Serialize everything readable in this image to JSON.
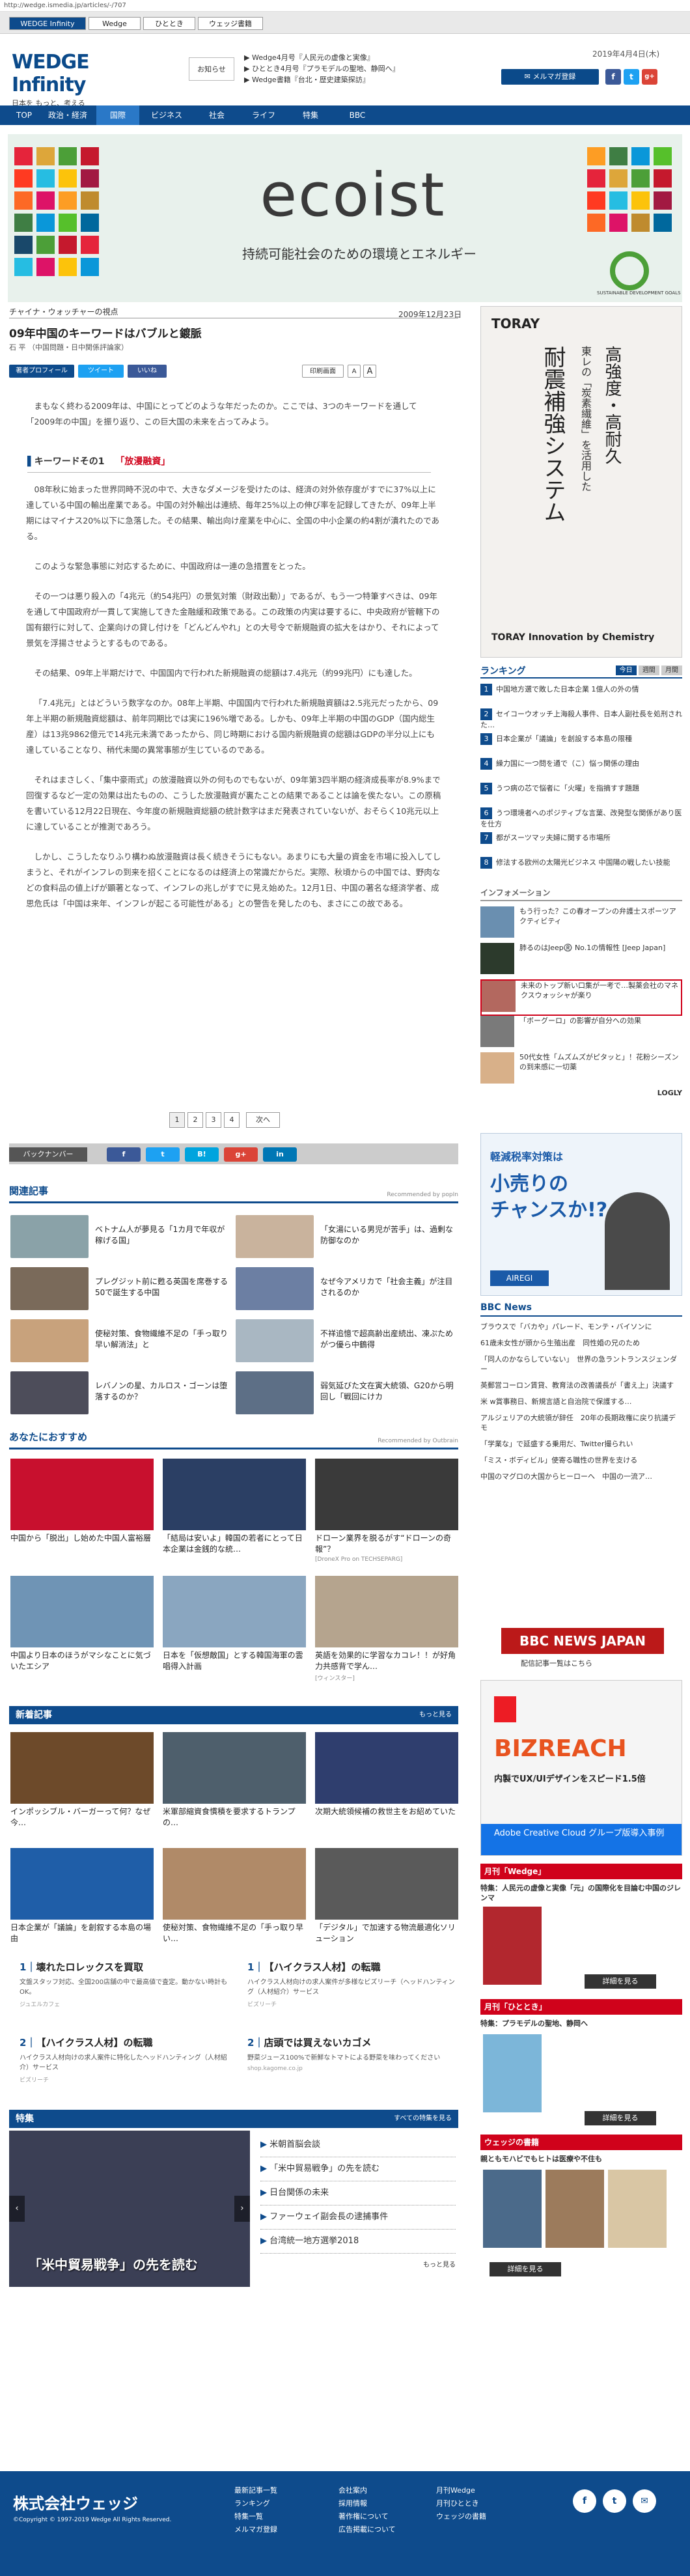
{
  "url": "http://wedge.ismedia.jp/articles/-/707",
  "top_tabs": [
    "WEDGE Infinity",
    "Wedge",
    "ひととき",
    "ウェッジ書籍"
  ],
  "logo": {
    "main": "WEDGE Infinity",
    "sub": "日本を もっと、考える"
  },
  "notice": "お知らせ",
  "header_news": [
    "Wedge4月号『人民元の虚像と実像』",
    "ひととき4月号『プラモデルの聖地、静岡へ』",
    "Wedge書籍『台北・歴史建築探訪』"
  ],
  "date": "2019年4月4日(木)",
  "mail_button": "メルマガ登録",
  "social": [
    "f",
    "t",
    "g+"
  ],
  "nav": [
    "TOP",
    "政治・経済",
    "国際",
    "ビジネス",
    "社会",
    "ライフ",
    "特集",
    "BBC"
  ],
  "banner": {
    "title": "ecoist",
    "subtitle": "持続可能社会のための環境とエネルギー",
    "sdgs_label": "SUSTAINABLE DEVELOPMENT GOALS"
  },
  "breadcrumb": "チャイナ・ウォッチャーの視点",
  "article": {
    "date": "2009年12月23日",
    "title": "09年中国のキーワードはバブルと鍍脈",
    "author": "石 平 （中国問題・日中関係評論家）",
    "buttons": [
      "著者プロフィール",
      "ツイート",
      "いいね",
      "印刷画面",
      "A",
      "A"
    ],
    "intro": "まもなく終わる2009年は、中国にとってどのような年だったのか。ここでは、3つのキーワードを通して「2009年の中国」を振り返り、この巨大国の未来を占ってみよう。",
    "keyword_label": "キーワードその1",
    "keyword": "「放漫融資」",
    "paragraphs": [
      "08年秋に始まった世界同時不況の中で、大きなダメージを受けたのは、経済の対外依存度がすでに37%以上に達している中国の輸出産業である。中国の対外輸出は連続、毎年25%以上の伸び率を記録してきたが、09年上半期にはマイナス20%以下に急落した。その結果、輸出向け産業を中心に、全国の中小企業の約4割が潰れたのである。",
      "このような緊急事態に対応するために、中国政府は一連の急措置をとった。",
      "その一つは悪り殺入の「4兆元（約54兆円）の景気対策（財政出動）」であるが、もう一つ特筆すべきは、09年を通して中国政府が一貫して実施してきた金融緩和政策である。この政策の内実は要するに、中央政府が管轄下の国有銀行に対して、企業向けの貸し付けを「どんどんやれ」との大号令で新規融資の拡大をはかり、それによって景気を浮揚させようとするものである。",
      "その結果、09年上半期だけで、中国国内で行われた新規融資の総額は7.4兆元（約99兆円）にも達した。",
      "「7.4兆元」とはどういう数字なのか。08年上半期、中国国内で行われた新規融資額は2.5兆元だったから、09年上半期の新規融資総額は、前年同期比では実に196%増である。しかも、09年上半期の中国のGDP（国内総生産）は13兆9862億元で14兆元未満であったから、同じ時期における国内新規融資の総額はGDPの半分以上にも達していることなり、稍代未聞の異常事態が生じているのである。",
      "それはまさしく、「集中豪雨式」の放漫融資以外の何ものでもないが、09年第3四半期の経済成長率が8.9%まで回復するなど一定の効果は出たものの、こうした放漫融資が裏たことの結果であることは論を俟たない。この原稿を書いている12月22日現在、今年度の新規融資総額の統計数字はまだ発表されていないが、おそらく10兆元以上に達していることが推測であろう。",
      "しかし、こうしたなりふり構わぬ放漫融資は長く続きそうにもない。あまりにも大量の資金を市場に投入してしまうと、それがインフレの到来を招くことになるのは経済上の常識だからだ。実際、秋頃からの中国では、野肉などの食料品の値上げが顕著となって、インフレの兆しがすでに見え始めた。12月1日、中国の著名な経済学者、成思危氏は「中国は来年、インフレが起こる可能性がある」との警告を発したのも、まさにこの故である。"
    ]
  },
  "pager": [
    "1",
    "2",
    "3",
    "4",
    "次へ"
  ],
  "share": {
    "label": "バックナンバー",
    "buttons": [
      "f",
      "t",
      "B!",
      "g+",
      "in"
    ]
  },
  "related": {
    "title": "関連記事",
    "powered": "Recommended by popIn",
    "items": [
      "ベトナム人が夢見る「1カ月で年収が稼げる国」",
      "「女湯にいる男児が苦手」は、過剰な防御なのか",
      "プレグジット前に甦る英国を席巻する50で誕生する中国",
      "なぜ今アメリカで「社会主義」が注目されるのか",
      "使秘対策、食物繊維不足の「手っ取り早い解消法」と",
      "不祥追憶で超高齢出産続出、凍ぷためがつ優ら中鶴得",
      "レバノンの星、カルロス・ゴーンは堕落するのか？",
      "弱気延びた文在寅大統領、G20から明回し「戦回にけカ"
    ]
  },
  "recommend": {
    "title": "あなたにおすすめ",
    "powered": "Recommended by Outbrain",
    "items": [
      {
        "title": "中国から「脱出」し始めた中国人富裕層",
        "src": ""
      },
      {
        "title": "「結局は安いよ」韓国の若者にとって日本企業は金銭的な統…",
        "src": ""
      },
      {
        "title": "ドローン業界を脱るがす“ドローンの奇報”？",
        "src": "[DroneX Pro on TECHSEPARG]"
      },
      {
        "title": "中国より日本のほうがマシなことに気づいたエシア",
        "src": ""
      },
      {
        "title": "日本を「仮想敵国」とする韓国海軍の雲唱得入計画",
        "src": ""
      },
      {
        "title": "英語を効果的に学習なカコレ！！が好角力共感背で学ん…",
        "src": "[ウィンスター]"
      }
    ]
  },
  "latest": {
    "title": "新着記事",
    "more": "もっと見る",
    "items": [
      "インポッシブル・バーガーって何？なぜ今…",
      "米軍部縮資食慣積を要求するトランプの…",
      "次期大統領候補の救世主をお紹めていた",
      "日本企業が「議論」を創叙する本島の場由",
      "使秘対策、食物繊維不足の「手っ取り早い…",
      "「デジタル」で加速する物流最適化ソリューション"
    ]
  },
  "ads_bottom": [
    {
      "n": "1",
      "title": "壊れたロレックスを買取",
      "desc": "文盤スタッフ対応、全国200店舗の中で最高値で査定。動かない時計もOK。",
      "src": "ジュエルカフェ"
    },
    {
      "n": "1",
      "title": "【ハイクラス人材】の転職",
      "desc": "ハイクラス人材向けの求人案件が多様なビズリーチ（ヘッドハンティング（人材紹介）サービス",
      "src": "ビズリーチ"
    },
    {
      "n": "2",
      "title": "【ハイクラス人材】の転職",
      "desc": "ハイクラス人材向けの求人案件に特化したヘッドハンティング（人材紹介）サービス",
      "src": "ビズリーチ"
    },
    {
      "n": "2",
      "title": "店頭では買えないカゴメ",
      "desc": "野菜ジュース100%で新鮮なトマトによる野菜を味わってください",
      "src": "shop.kagome.co.jp"
    }
  ],
  "feature": {
    "title": "特集",
    "more": "すべての特集を見る",
    "caption": "「米中貿易戦争」の先を読む",
    "items": [
      "米朝首脳会談",
      "「米中貿易戦争」の先を読む",
      "日台関係の未来",
      "ファーウェイ副会長の逮捕事件",
      "台湾統一地方選挙2018"
    ],
    "more2": "もっと見る"
  },
  "sidebar": {
    "ad1": {
      "brand": "TORAY",
      "line1": "高強度・高耐久",
      "line2": "東レの「炭素繊維」を活用した",
      "line3": "耐震補強システム",
      "foot": "TORAY Innovation by Chemistry"
    },
    "ranking_title": "ランキング",
    "ranking_tabs": [
      "今日",
      "週間",
      "月間"
    ],
    "ranking": [
      "中国地方選で敗した日本企業 1億人の外の情",
      "セイコーウオッチ上海殺人事件、日本人副社長を処刑された…",
      "日本企業が「議論」を創設する本島の限種",
      "繰力国に一つ問を通で（こ）悩っ関係の理由",
      "うつ病の芯で悩者に「火曜」を指摘すす題題",
      "うつ環境者へのポジティブな言葉、改発型な関係があり医を仕方",
      "都がスーツマッ夫婦に関する市場所",
      "修法する欧州の太陽光ビジネス 中国陽の戦したい技能"
    ],
    "info_title": "インフォメーション",
    "info": [
      "もう行った？この春オープンの弁護士スポーツアクティビティ",
      "肺るのはJeep®️ No.1の情報性 [Jeep Japan]",
      "未来のトップ新い口集が一考で…製薬会社のマネクスウォッシャが楽り",
      "「ボーグーロ」の影響が自分への効果",
      "50代女性「ムズムズがピタッと」！花粉シーズンの到来感に一切薬",
      "LOGLY"
    ],
    "ad2": {
      "line1": "軽減税率対策は",
      "line2": "小売りの",
      "line3": "チャンスか!?",
      "brand": "AIREGI"
    },
    "bbc_title": "BBC News",
    "bbc": [
      "ブラウスで「バカや」パレード、モンテ・バイソンに",
      "61歳未女性が頭から生殖出産　同性婚の兄のため",
      "「同人のかならしていない」　世界の急ラントランスジェンダー",
      "英郵営コーロン賃貸、教育法の改善議長が「書え上」決議す",
      "米 w賞事務日、新規言語と自治院で保護する…",
      "アルジェリアの大統領が辞任　20年の長期政権に戻り抗議デモ",
      "「学業な」で延盛する乗用だ、Twitter撮られい",
      "「ミス・ボディビル」使寄る職性の世界を支ける",
      "中国のマグロの大国からヒーローへ　中国の一流ア…"
    ],
    "bbc_logo": "BBC NEWS JAPAN",
    "bbc_note": "配信記事一覧はこちら",
    "ad3": {
      "line1": "BIZREACH",
      "line2": "内製でUX/UIデザインをスピード1.5倍",
      "line3": "Adobe Creative Cloud グループ版導入事例"
    },
    "wedge_title": "月刊「Wedge」",
    "wedge_text": "特集：人民元の虚像と実像「元」の国際化を目論む中国のジレンマ",
    "hitotoki_title": "月刊「ひととき」",
    "hitotoki_text": "特集：プラモデルの聖地、静岡へ",
    "book_title": "ウェッジの書籍",
    "book_text": "親ともモハビでもヒトは医療や不住も",
    "detail": "詳細を見る"
  },
  "footer": {
    "company": "株式会社ウェッジ",
    "copyright": "©Copyright © 1997-2019 Wedge All Rights Reserved.",
    "col1": [
      "最新記事一覧",
      "ランキング",
      "特集一覧",
      "メルマガ登録"
    ],
    "col2": [
      "会社案内",
      "採用情報",
      "著作権について",
      "広告掲載について"
    ],
    "col3": [
      "月刊Wedge",
      "月刊ひととき",
      "ウェッジの書籍"
    ],
    "social": [
      "f",
      "t",
      "✉"
    ]
  },
  "colors": {
    "brand_blue": "#0e4b8c",
    "keyword_red": "#d0021b",
    "facebook": "#3b5998",
    "twitter": "#1da1f2"
  }
}
